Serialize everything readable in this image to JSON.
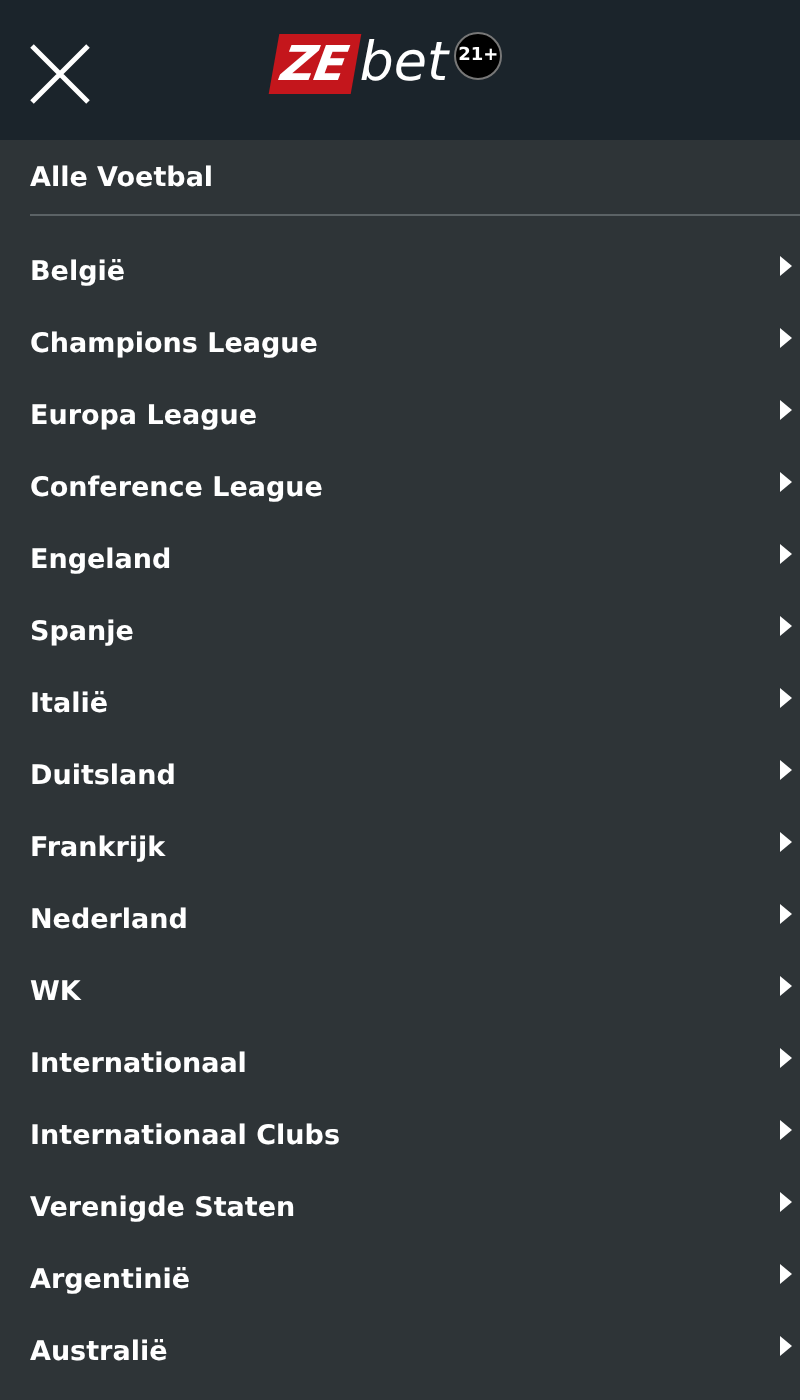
{
  "header": {
    "logo_part_1": "ZE",
    "logo_part_2": "bet",
    "age_badge": "21+"
  },
  "all_link": "Alle Voetbal",
  "items": [
    {
      "label": "België"
    },
    {
      "label": "Champions League"
    },
    {
      "label": "Europa League"
    },
    {
      "label": "Conference League"
    },
    {
      "label": "Engeland"
    },
    {
      "label": "Spanje"
    },
    {
      "label": "Italië"
    },
    {
      "label": "Duitsland"
    },
    {
      "label": "Frankrijk"
    },
    {
      "label": "Nederland"
    },
    {
      "label": "WK"
    },
    {
      "label": "Internationaal"
    },
    {
      "label": "Internationaal Clubs"
    },
    {
      "label": "Verenigde Staten"
    },
    {
      "label": "Argentinië"
    },
    {
      "label": "Australië"
    }
  ]
}
